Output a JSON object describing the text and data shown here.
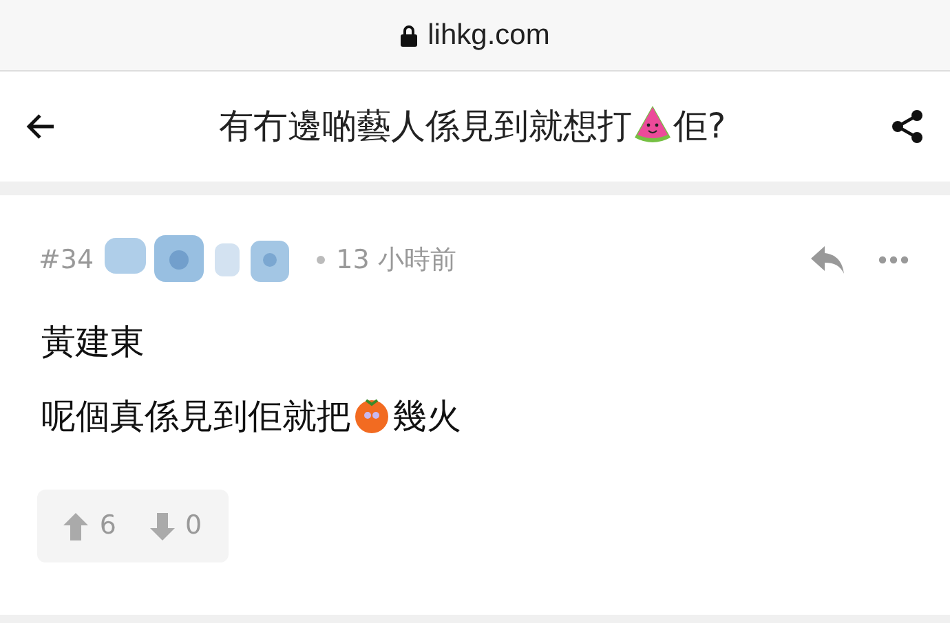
{
  "address_bar": {
    "url": "lihkg.com",
    "secure": true
  },
  "header": {
    "title": [
      {
        "kind": "text",
        "text": "有冇邊啲藝人係見到就想打"
      },
      {
        "kind": "watermelon"
      },
      {
        "kind": "text",
        "text": "佢?"
      }
    ]
  },
  "post": {
    "number": "#34",
    "time": "13 小時前",
    "lines": [
      [
        {
          "kind": "text",
          "text": "黃建東"
        }
      ],
      [
        {
          "kind": "text",
          "text": "呢個真係見到佢就把"
        },
        {
          "kind": "orange"
        },
        {
          "kind": "text",
          "text": "幾火"
        }
      ]
    ],
    "upvotes": "6",
    "downvotes": "0"
  }
}
